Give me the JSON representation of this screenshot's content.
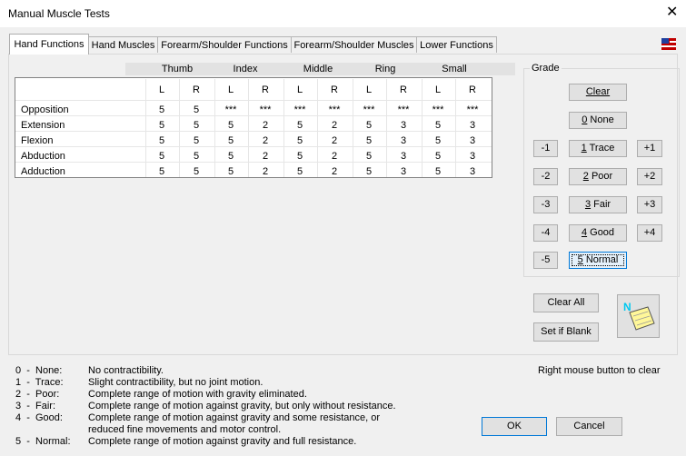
{
  "window": {
    "title": "Manual Muscle Tests",
    "close_glyph": "✕"
  },
  "tabs": [
    "Hand Functions",
    "Hand Muscles",
    "Forearm/Shoulder Functions",
    "Forearm/Shoulder Muscles",
    "Lower Functions"
  ],
  "grid": {
    "fingers": [
      "Thumb",
      "Index",
      "Middle",
      "Ring",
      "Small"
    ],
    "sides": [
      "L",
      "R",
      "L",
      "R",
      "L",
      "R",
      "L",
      "R",
      "L",
      "R"
    ],
    "rows": [
      {
        "label": "Opposition",
        "values": [
          "5",
          "5",
          "***",
          "***",
          "***",
          "***",
          "***",
          "***",
          "***",
          "***"
        ]
      },
      {
        "label": "Extension",
        "values": [
          "5",
          "5",
          "5",
          "2",
          "5",
          "2",
          "5",
          "3",
          "5",
          "3"
        ]
      },
      {
        "label": "Flexion",
        "values": [
          "5",
          "5",
          "5",
          "2",
          "5",
          "2",
          "5",
          "3",
          "5",
          "3"
        ]
      },
      {
        "label": "Abduction",
        "values": [
          "5",
          "5",
          "5",
          "2",
          "5",
          "2",
          "5",
          "3",
          "5",
          "3"
        ]
      },
      {
        "label": "Adduction",
        "values": [
          "5",
          "5",
          "5",
          "2",
          "5",
          "2",
          "5",
          "3",
          "5",
          "3"
        ]
      }
    ]
  },
  "grade": {
    "group_label": "Grade",
    "clear": "Clear",
    "levels": [
      {
        "key": "0",
        "text": " None"
      },
      {
        "key": "1",
        "text": " Trace"
      },
      {
        "key": "2",
        "text": " Poor"
      },
      {
        "key": "3",
        "text": " Fair"
      },
      {
        "key": "4",
        "text": " Good"
      },
      {
        "key": "5",
        "text": " Normal"
      }
    ],
    "minus": [
      "-1",
      "-2",
      "-3",
      "-4",
      "-5"
    ],
    "plus": [
      "+1",
      "+2",
      "+3",
      "+4"
    ]
  },
  "actions": {
    "clear_all": "Clear All",
    "set_if_blank": "Set if Blank"
  },
  "legend": [
    {
      "code": "0  -  None:",
      "desc": "No contractibility."
    },
    {
      "code": "1  -  Trace:",
      "desc": "Slight contractibility, but no joint motion."
    },
    {
      "code": "2  -  Poor:",
      "desc": "Complete range of motion with gravity eliminated."
    },
    {
      "code": "3  -  Fair:",
      "desc": "Complete range of motion against gravity, but only without resistance."
    },
    {
      "code": "4  -  Good:",
      "desc": "Complete range of motion against gravity and some resistance, or"
    },
    {
      "code": "",
      "desc": "reduced fine movements and motor control."
    },
    {
      "code": "5  -  Normal:",
      "desc": "Complete range of motion against gravity and full resistance."
    }
  ],
  "hint": "Right mouse button to clear",
  "footer": {
    "ok": "OK",
    "cancel": "Cancel"
  }
}
